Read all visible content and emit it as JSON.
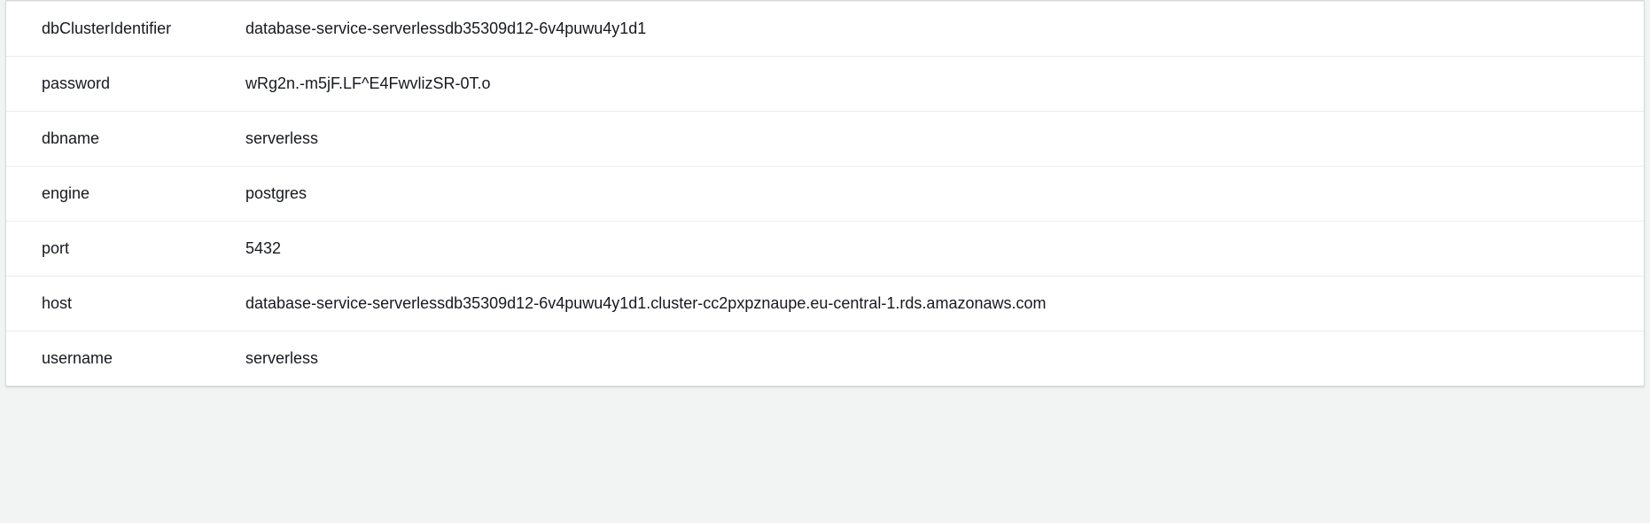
{
  "secret": {
    "rows": [
      {
        "key": "dbClusterIdentifier",
        "value": "database-service-serverlessdb35309d12-6v4puwu4y1d1"
      },
      {
        "key": "password",
        "value": "wRg2n.-m5jF.LF^E4FwvlizSR-0T.o"
      },
      {
        "key": "dbname",
        "value": "serverless"
      },
      {
        "key": "engine",
        "value": "postgres"
      },
      {
        "key": "port",
        "value": "5432"
      },
      {
        "key": "host",
        "value": "database-service-serverlessdb35309d12-6v4puwu4y1d1.cluster-cc2pxpznaupe.eu-central-1.rds.amazonaws.com"
      },
      {
        "key": "username",
        "value": "serverless"
      }
    ]
  }
}
